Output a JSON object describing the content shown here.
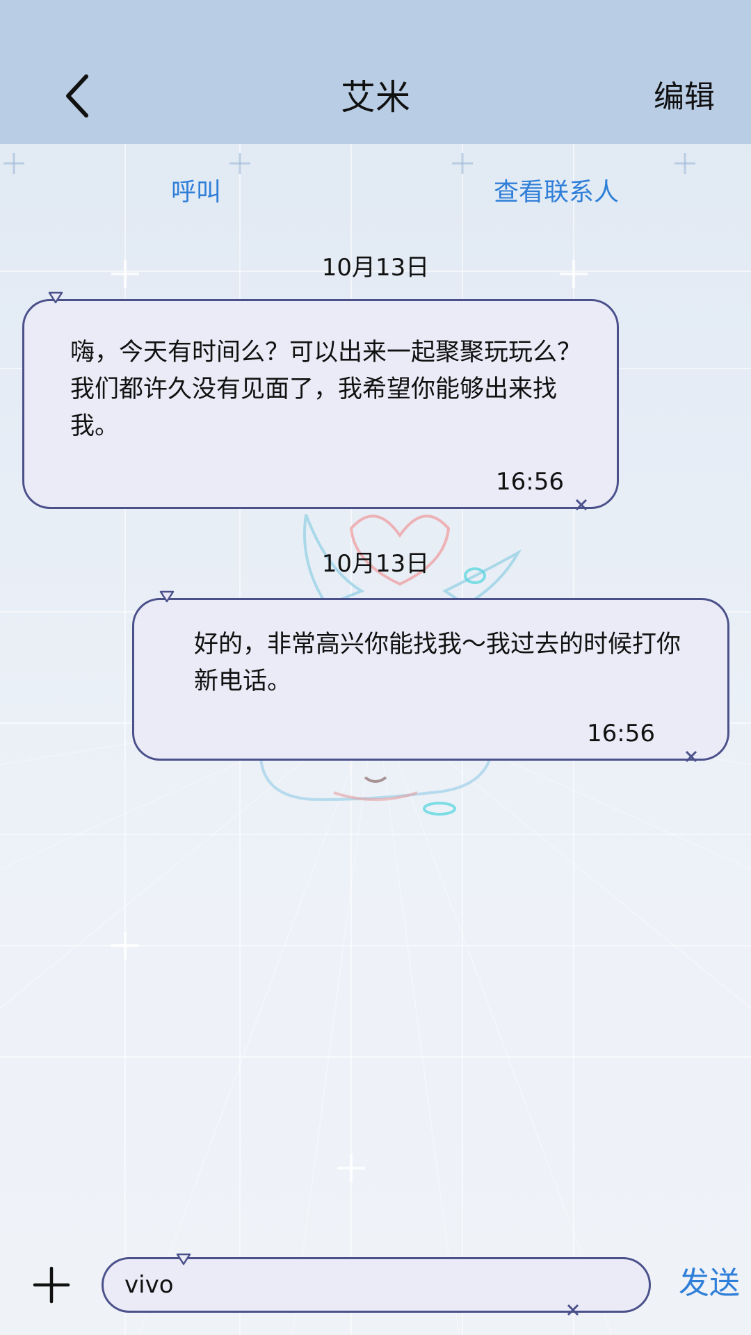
{
  "header": {
    "back_icon": "chevron-left-icon",
    "title": "艾米",
    "edit_label": "编辑",
    "background": "#b9cde5"
  },
  "actions": {
    "call_label": "呼叫",
    "view_contact_label": "查看联系人",
    "accent": "#2f7fd8"
  },
  "messages": [
    {
      "date": "10月13日",
      "text": "嗨，今天有时间么？可以出来一起聚聚玩玩么？我们都许久没有见面了，我希望你能够出来找我。",
      "time": "16:56",
      "direction": "incoming"
    },
    {
      "date": "10月13日",
      "text": "好的，非常高兴你能找我～我过去的时候打你新电话。",
      "time": "16:56",
      "direction": "outgoing"
    }
  ],
  "bubble_style": {
    "fill": "#ebebf7",
    "border": "#4a508a"
  },
  "composer": {
    "add_icon": "plus-icon",
    "input_value": "vivo",
    "send_label": "发送"
  }
}
